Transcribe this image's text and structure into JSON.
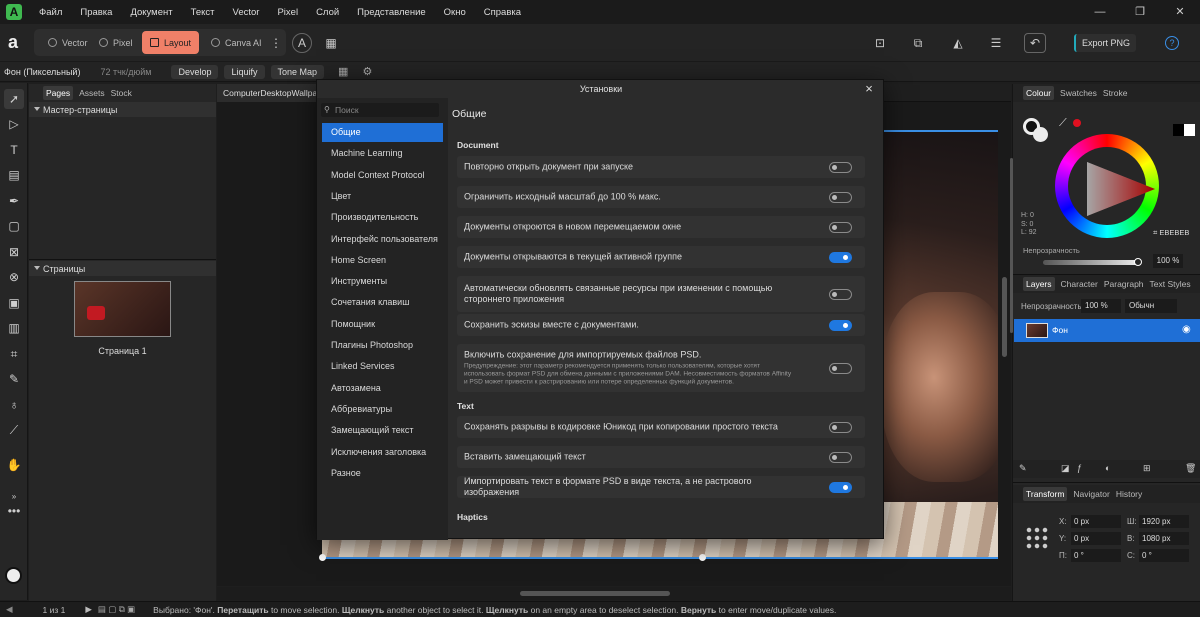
{
  "app": {
    "logo": "A"
  },
  "menu": [
    "Файл",
    "Правка",
    "Документ",
    "Текст",
    "Vector",
    "Pixel",
    "Слой",
    "Представление",
    "Окно",
    "Справка"
  ],
  "toolbar": {
    "personas": [
      {
        "label": "Vector",
        "active": false
      },
      {
        "label": "Pixel",
        "active": false
      },
      {
        "label": "Layout",
        "active": true
      },
      {
        "label": "Canva AI",
        "active": false
      }
    ],
    "export_label": "Export PNG",
    "help_label": "?"
  },
  "context": {
    "layer_name": "Фон (Пиксельный)",
    "dpi": "72 тчк/дюйм",
    "buttons": [
      "Develop",
      "Liquify",
      "Tone Map"
    ]
  },
  "pages_panel": {
    "tabs": [
      "Pages",
      "Assets",
      "Stock"
    ],
    "master_header": "Мастер-страницы",
    "pages_header": "Страницы",
    "page_caption": "Страница 1"
  },
  "document_tab": "ComputerDesktopWallpaper",
  "right_panel": {
    "colour_tabs": [
      "Colour",
      "Swatches",
      "Stroke"
    ],
    "hsl": {
      "h": "H: 0",
      "s": "S: 0",
      "l": "L: 92"
    },
    "hex": "EBEBEB",
    "opacity_label": "Непрозрачность",
    "opacity_value": "100 %",
    "layer_tabs": [
      "Layers",
      "Character",
      "Paragraph",
      "Text Styles"
    ],
    "layer_opacity_label": "Непрозрачность:",
    "layer_opacity_value": "100 %",
    "blend_mode": "Обычн",
    "layer_name": "Фон",
    "transform_tabs": [
      "Transform",
      "Navigator",
      "History"
    ],
    "transform": {
      "x_label": "X:",
      "x": "0 px",
      "y_label": "Y:",
      "y": "0 px",
      "w_label": "Ш:",
      "w": "1920 px",
      "h_label": "В:",
      "h": "1080 px",
      "r_label": "П:",
      "r": "0 °",
      "s_label": "С:",
      "s": "0 °"
    }
  },
  "status": {
    "pages": "1 из 1",
    "message_parts": [
      "Выбрано: 'Фон'. ",
      "Перетащить",
      " to move selection. ",
      "Щелкнуть",
      " another object to select it. ",
      "Щелкнуть",
      " on an empty area to deselect selection. ",
      "Вернуть",
      " to enter move/duplicate values."
    ]
  },
  "dialog": {
    "title": "Установки",
    "close": "×",
    "search_placeholder": "Поиск",
    "categories": [
      "Общие",
      "Machine Learning",
      "Model Context Protocol",
      "Цвет",
      "Производительность",
      "Интерфейс пользователя",
      "Home Screen",
      "Инструменты",
      "Сочетания клавиш",
      "Помощник",
      "Плагины Photoshop",
      "Linked Services",
      "Автозамена",
      "Аббревиатуры",
      "Замещающий текст",
      "Исключения заголовка",
      "Разное"
    ],
    "selected_category": "Общие",
    "main_title": "Общие",
    "groups": [
      {
        "title": "Document",
        "settings": [
          {
            "label": "Повторно открыть документ при запуске",
            "on": false
          },
          {
            "label": "Ограничить исходный масштаб до 100 % макс.",
            "on": false
          },
          {
            "label": "Документы откроются в новом перемещаемом окне",
            "on": false
          },
          {
            "label": "Документы открываются в текущей активной группе",
            "on": true
          },
          {
            "label": "Автоматически обновлять связанные ресурсы при изменении с помощью стороннего приложения",
            "on": false
          },
          {
            "label": "Сохранить эскизы вместе с документами.",
            "on": true
          },
          {
            "label": "Включить сохранение для импортируемых файлов PSD.",
            "on": false,
            "note": "Предупреждение: этот параметр рекомендуется применять только пользователям, которые хотят использовать формат PSD для обмена данными с приложениями DAM. Несовместимость форматов Affinity и PSD может привести к растрированию или потере определенных функций документов."
          }
        ]
      },
      {
        "title": "Text",
        "settings": [
          {
            "label": "Сохранять разрывы в кодировке Юникод при копировании простого текста",
            "on": false
          },
          {
            "label": "Вставить замещающий текст",
            "on": false
          },
          {
            "label": "Импортировать текст в формате PSD в виде текста, а не растрового изображения",
            "on": true
          }
        ]
      },
      {
        "title": "Haptics",
        "settings": []
      }
    ]
  },
  "colors": {
    "accent": "#1f78e0",
    "layout_persona": "#f08068",
    "brand": "#3fb950"
  }
}
